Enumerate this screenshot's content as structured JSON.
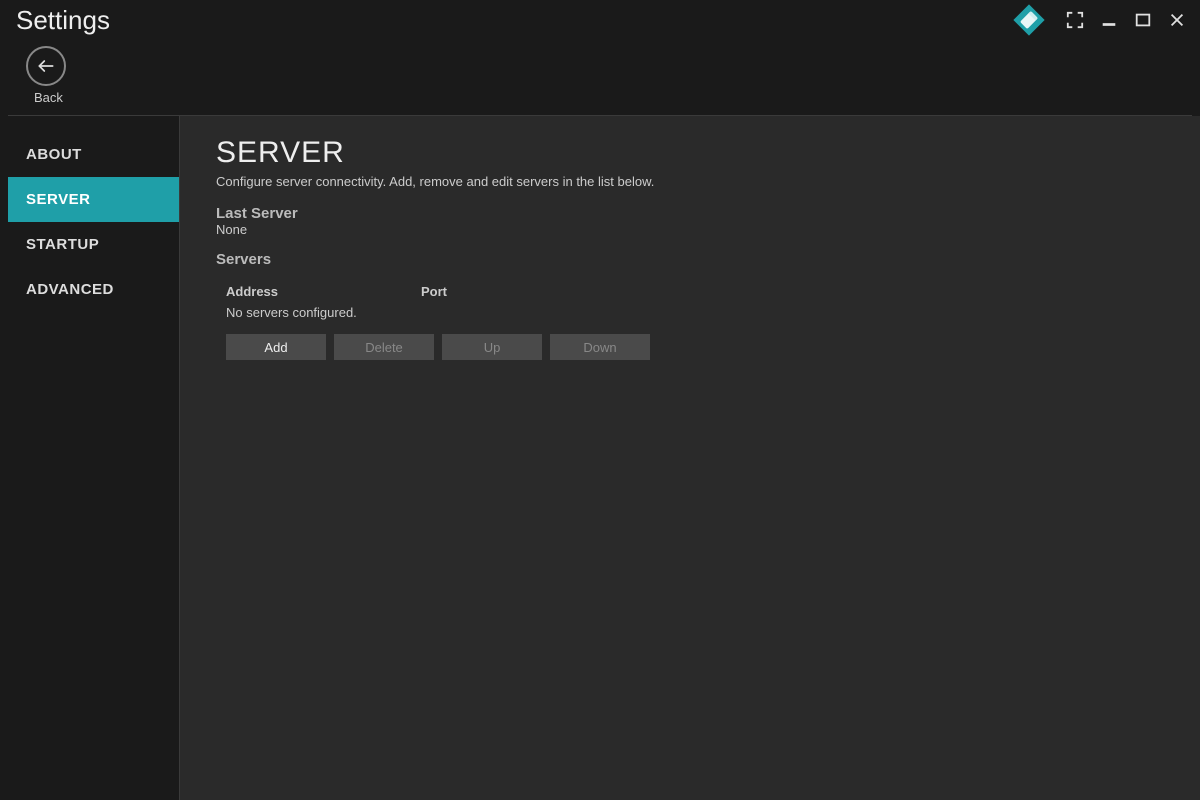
{
  "window": {
    "title": "Settings"
  },
  "back": {
    "label": "Back"
  },
  "sidebar": {
    "items": [
      {
        "label": "ABOUT",
        "active": false
      },
      {
        "label": "SERVER",
        "active": true
      },
      {
        "label": "STARTUP",
        "active": false
      },
      {
        "label": "ADVANCED",
        "active": false
      }
    ]
  },
  "page": {
    "title": "SERVER",
    "description": "Configure server connectivity. Add, remove and edit servers in the list below.",
    "lastServer": {
      "label": "Last Server",
      "value": "None"
    },
    "servers": {
      "label": "Servers",
      "columns": {
        "address": "Address",
        "port": "Port"
      },
      "emptyMessage": "No servers configured.",
      "buttons": {
        "add": "Add",
        "delete": "Delete",
        "up": "Up",
        "down": "Down"
      }
    }
  },
  "colors": {
    "accent": "#1f9fa8",
    "panel": "#2a2a2a",
    "bg": "#1a1a1a"
  }
}
